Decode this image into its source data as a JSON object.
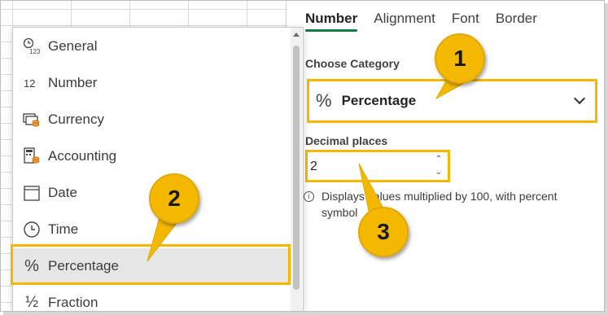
{
  "dropdown": {
    "items": [
      {
        "icon": "general-icon",
        "label": "General"
      },
      {
        "icon": "number-icon",
        "label": "Number"
      },
      {
        "icon": "currency-icon",
        "label": "Currency"
      },
      {
        "icon": "accounting-icon",
        "label": "Accounting"
      },
      {
        "icon": "calendar-icon",
        "label": "Date"
      },
      {
        "icon": "clock-icon",
        "label": "Time"
      },
      {
        "icon": "percent-icon",
        "label": "Percentage",
        "selected": true
      },
      {
        "icon": "fraction-icon",
        "label": "Fraction"
      }
    ]
  },
  "panel": {
    "tabs": [
      "Number",
      "Alignment",
      "Font",
      "Border"
    ],
    "active_tab": "Number",
    "category_label": "Choose Category",
    "category_value": "Percentage",
    "category_symbol": "%",
    "decimal_label": "Decimal places",
    "decimal_value": "2",
    "hint": "Displays values multiplied by 100, with percent symbol"
  },
  "callouts": [
    "1",
    "2",
    "3"
  ],
  "colors": {
    "highlight": "#f5b800",
    "tab_underline": "#107c41",
    "selected_row": "#e6e6e6"
  }
}
